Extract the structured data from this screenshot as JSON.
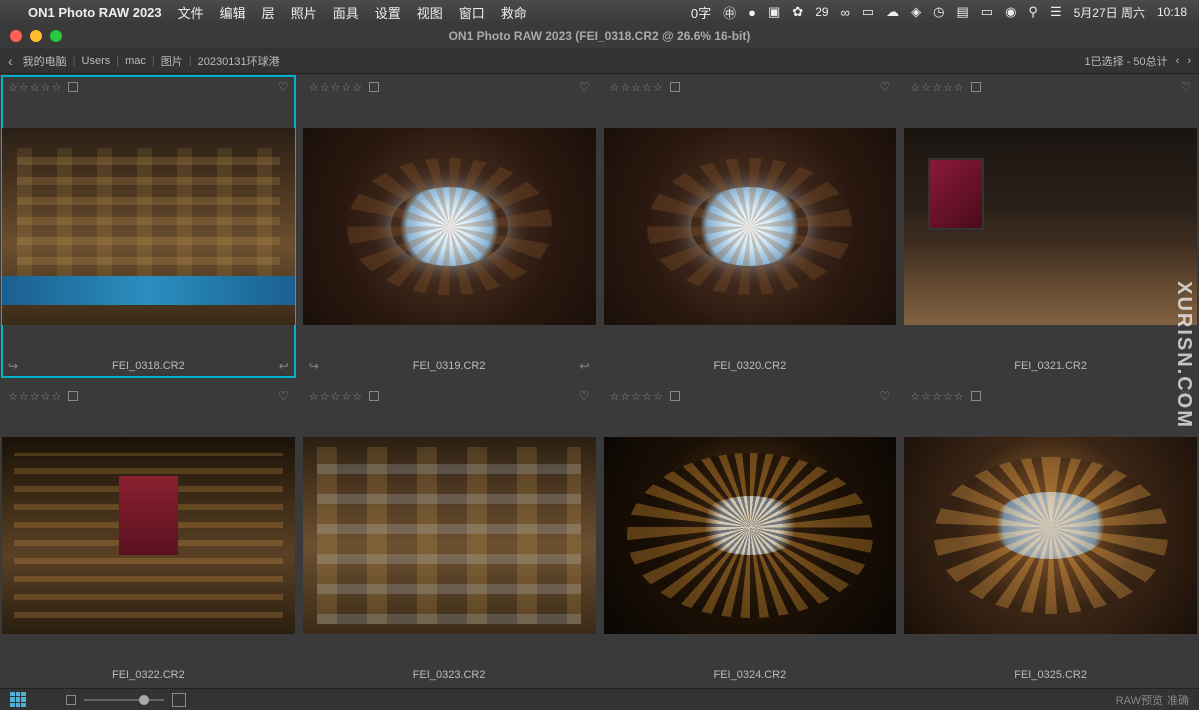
{
  "menubar": {
    "app": "ON1 Photo RAW 2023",
    "items": [
      "文件",
      "编辑",
      "层",
      "照片",
      "面具",
      "设置",
      "视图",
      "窗口",
      "救命"
    ],
    "right": {
      "ime": "0字",
      "count": "29",
      "date": "5月27日 周六",
      "time": "10:18"
    }
  },
  "titlebar": {
    "title": "ON1 Photo RAW 2023 (FEI_0318.CR2 @ 26.6% 16-bit)"
  },
  "breadcrumb": {
    "items": [
      "我的电脑",
      "Users",
      "mac",
      "图片",
      "20230131环球港"
    ],
    "status": "1已选择 - 50总计"
  },
  "thumbs": [
    {
      "name": "FEI_0318.CR2",
      "selected": true,
      "style": "mall",
      "arrows": true
    },
    {
      "name": "FEI_0319.CR2",
      "selected": false,
      "style": "dome",
      "arrows": true
    },
    {
      "name": "FEI_0320.CR2",
      "selected": false,
      "style": "dome",
      "arrows": false
    },
    {
      "name": "FEI_0321.CR2",
      "selected": false,
      "style": "corr",
      "arrows": false
    },
    {
      "name": "FEI_0322.CR2",
      "selected": false,
      "style": "mall2",
      "arrows": false
    },
    {
      "name": "FEI_0323.CR2",
      "selected": false,
      "style": "mall3",
      "arrows": false
    },
    {
      "name": "FEI_0324.CR2",
      "selected": false,
      "style": "dome-dark",
      "arrows": false
    },
    {
      "name": "FEI_0325.CR2",
      "selected": false,
      "style": "dome-gold",
      "arrows": false
    }
  ],
  "bottombar": {
    "raw_label": "RAW预览",
    "accurate": "准确"
  },
  "watermark": "XURISN.COM"
}
